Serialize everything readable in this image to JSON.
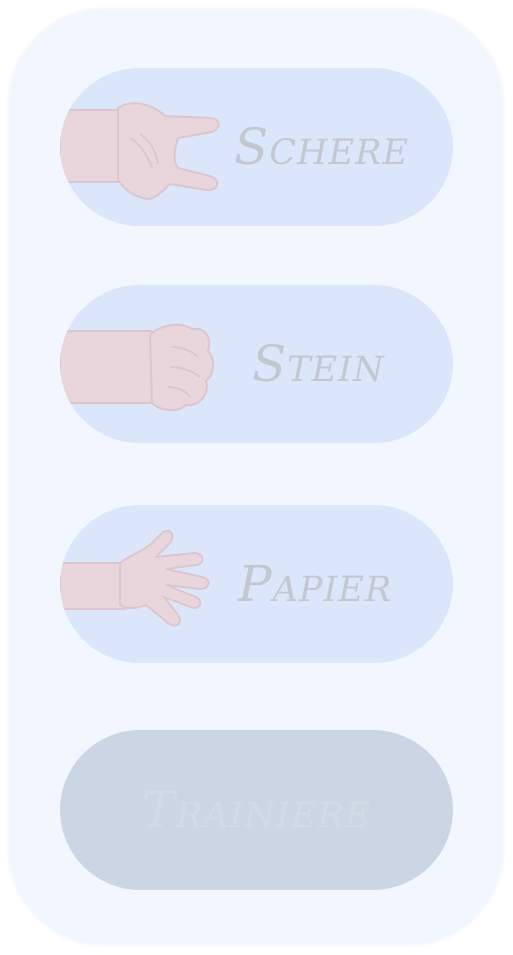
{
  "choices": [
    {
      "id": "scissors",
      "label": "Schere",
      "icon": "scissors-hand-icon"
    },
    {
      "id": "rock",
      "label": "Stein",
      "icon": "rock-fist-icon"
    },
    {
      "id": "paper",
      "label": "Papier",
      "icon": "open-hand-icon"
    }
  ],
  "train_button": {
    "label": "Trainiere"
  },
  "colors": {
    "panel_background": "#f2f6ff",
    "choice_background": "#dce6fb",
    "choice_text": "#c3c7d0",
    "hand_skin": "#e8d6dc",
    "train_background": "#cbd5e3",
    "train_text": "#d3dae5"
  }
}
